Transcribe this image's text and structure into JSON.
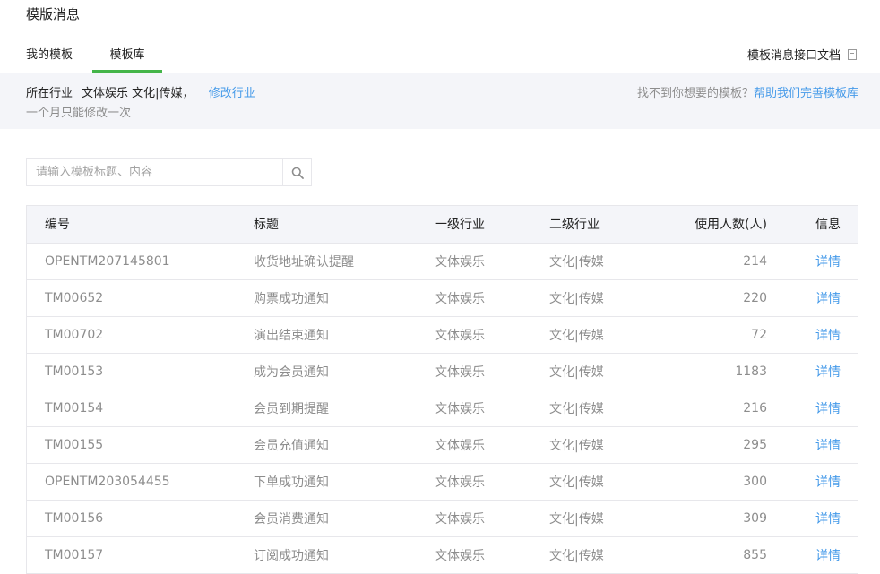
{
  "page": {
    "title": "模版消息"
  },
  "tabs": {
    "mine_label": "我的模板",
    "library_label": "模板库",
    "doc_link_label": "模板消息接口文档"
  },
  "industry": {
    "prefix": "所在行业",
    "primary": "文体娱乐",
    "secondary": "文化|传媒",
    "separator": "，",
    "modify_label": "修改行业",
    "note": "一个月只能修改一次",
    "help_prefix": "找不到你想要的模板？",
    "help_link": "帮助我们完善模板库"
  },
  "search": {
    "placeholder": "请输入模板标题、内容",
    "value": ""
  },
  "table": {
    "headers": {
      "id": "编号",
      "title": "标题",
      "industry1": "一级行业",
      "industry2": "二级行业",
      "count": "使用人数(人)",
      "info": "信息"
    },
    "rows": [
      {
        "id": "OPENTM207145801",
        "title": "收货地址确认提醒",
        "industry1": "文体娱乐",
        "industry2": "文化|传媒",
        "count": "214",
        "info": "详情"
      },
      {
        "id": "TM00652",
        "title": "购票成功通知",
        "industry1": "文体娱乐",
        "industry2": "文化|传媒",
        "count": "220",
        "info": "详情"
      },
      {
        "id": "TM00702",
        "title": "演出结束通知",
        "industry1": "文体娱乐",
        "industry2": "文化|传媒",
        "count": "72",
        "info": "详情"
      },
      {
        "id": "TM00153",
        "title": "成为会员通知",
        "industry1": "文体娱乐",
        "industry2": "文化|传媒",
        "count": "1183",
        "info": "详情"
      },
      {
        "id": "TM00154",
        "title": "会员到期提醒",
        "industry1": "文体娱乐",
        "industry2": "文化|传媒",
        "count": "216",
        "info": "详情"
      },
      {
        "id": "TM00155",
        "title": "会员充值通知",
        "industry1": "文体娱乐",
        "industry2": "文化|传媒",
        "count": "295",
        "info": "详情"
      },
      {
        "id": "OPENTM203054455",
        "title": "下单成功通知",
        "industry1": "文体娱乐",
        "industry2": "文化|传媒",
        "count": "300",
        "info": "详情"
      },
      {
        "id": "TM00156",
        "title": "会员消费通知",
        "industry1": "文体娱乐",
        "industry2": "文化|传媒",
        "count": "309",
        "info": "详情"
      },
      {
        "id": "TM00157",
        "title": "订阅成功通知",
        "industry1": "文体娱乐",
        "industry2": "文化|传媒",
        "count": "855",
        "info": "详情"
      }
    ]
  },
  "colors": {
    "accent_green": "#44b549",
    "link_blue": "#459ae9",
    "muted_text": "#8d8d8d",
    "panel_bg": "#f4f5f9"
  }
}
